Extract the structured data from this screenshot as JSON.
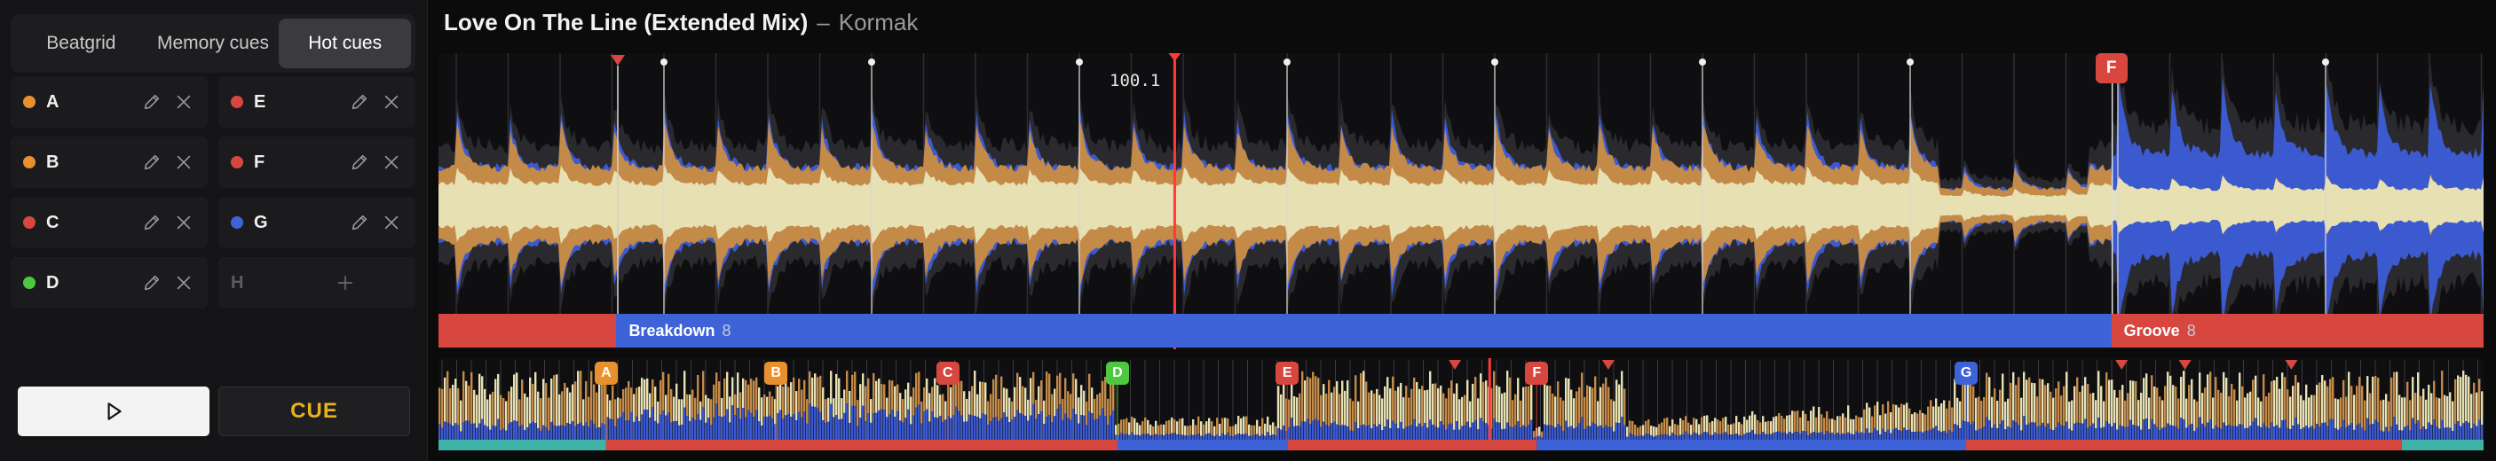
{
  "tabs": [
    {
      "label": "Beatgrid",
      "active": false
    },
    {
      "label": "Memory cues",
      "active": false
    },
    {
      "label": "Hot cues",
      "active": true
    }
  ],
  "hot_cues": [
    {
      "label": "A",
      "color": "#e8902e",
      "set": true
    },
    {
      "label": "E",
      "color": "#d8473f",
      "set": true
    },
    {
      "label": "B",
      "color": "#e8902e",
      "set": true
    },
    {
      "label": "F",
      "color": "#d8473f",
      "set": true
    },
    {
      "label": "C",
      "color": "#d8473f",
      "set": true
    },
    {
      "label": "G",
      "color": "#3e63d8",
      "set": true
    },
    {
      "label": "D",
      "color": "#4ec93f",
      "set": true
    },
    {
      "label": "H",
      "color": null,
      "set": false
    }
  ],
  "transport": {
    "cue_label": "CUE",
    "cue_color": "#e7b21e"
  },
  "track": {
    "title": "Love On The Line (Extended Mix)",
    "separator": "–",
    "artist": "Kormak"
  },
  "main_wave": {
    "bpm_readout": "100.1",
    "memory_cue_marker": "F",
    "phrases": [
      {
        "name": "",
        "count": "",
        "color": "#d8473f",
        "start": 0.0,
        "end": 0.087
      },
      {
        "name": "Breakdown",
        "count": "8",
        "color": "#3e63d8",
        "start": 0.087,
        "end": 0.818
      },
      {
        "name": "Groove",
        "count": "8",
        "color": "#d8473f",
        "start": 0.818,
        "end": 1.0
      }
    ],
    "playhead_fraction": 0.36
  },
  "overview": {
    "playhead_fraction": 0.514,
    "hot_cue_markers": [
      {
        "label": "A",
        "color": "#e8902e",
        "pos": 0.082
      },
      {
        "label": "B",
        "color": "#e8902e",
        "pos": 0.165
      },
      {
        "label": "C",
        "color": "#d8473f",
        "pos": 0.249
      },
      {
        "label": "D",
        "color": "#4ec93f",
        "pos": 0.332
      },
      {
        "label": "E",
        "color": "#d8473f",
        "pos": 0.415
      },
      {
        "label": "F",
        "color": "#d8473f",
        "pos": 0.537
      },
      {
        "label": "G",
        "color": "#3e63d8",
        "pos": 0.747
      }
    ],
    "memory_cue_positions": [
      0.497,
      0.572,
      0.823,
      0.854,
      0.906
    ]
  },
  "icons": {
    "edit": "pencil-icon",
    "delete": "close-icon",
    "add": "plus-icon",
    "play": "play-icon"
  }
}
